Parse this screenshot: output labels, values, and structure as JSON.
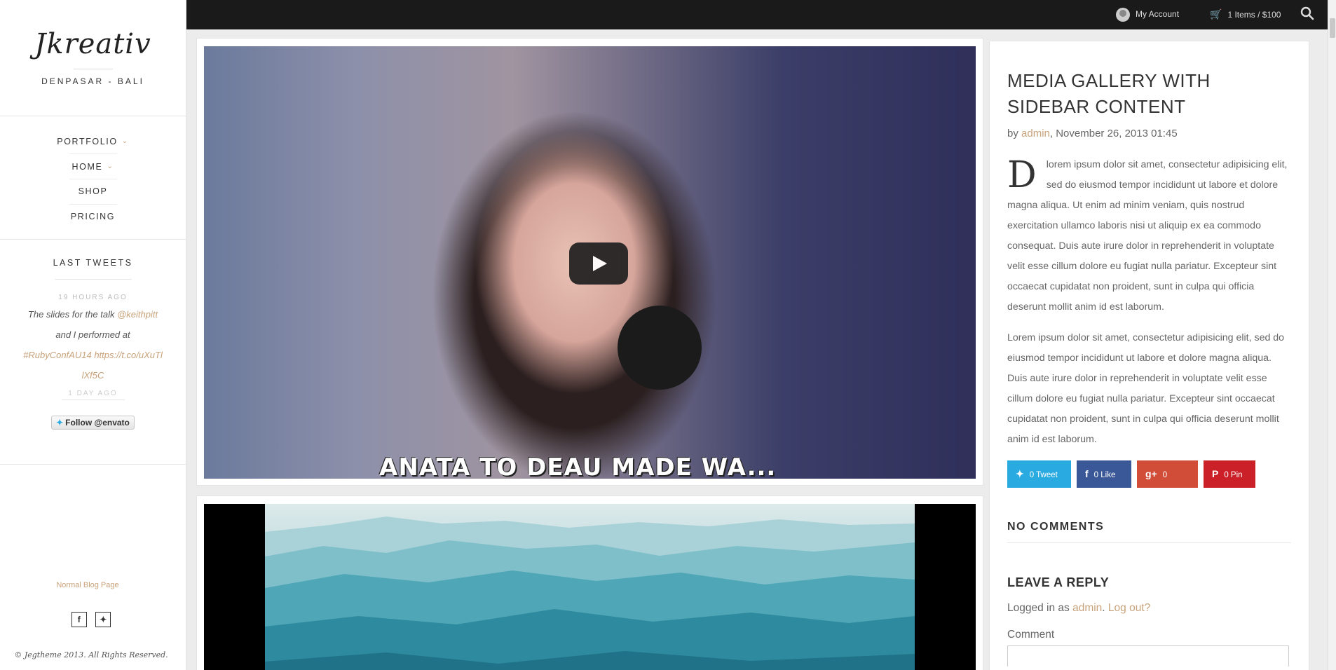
{
  "sidebar": {
    "brand": "Jkreativ",
    "tagline": "DENPASAR - BALI",
    "nav": [
      {
        "label": "PORTFOLIO",
        "has_submenu": true
      },
      {
        "label": "HOME",
        "has_submenu": true
      },
      {
        "label": "SHOP",
        "has_submenu": false
      },
      {
        "label": "PRICING",
        "has_submenu": false
      }
    ],
    "tweets": {
      "heading": "LAST TWEETS",
      "time": "19 HOURS AGO",
      "text_1": "The slides for the talk ",
      "mention": "@keithpitt",
      "text_2": " and I performed at ",
      "hashtag": "#RubyConfAU14",
      "text_3": " ",
      "link": "https://t.co/uXuTllXf5C",
      "next_time": "1 DAY AGO"
    },
    "follow_button": "Follow @envato",
    "blog_link": "Normal Blog Page",
    "copyright": "© Jegtheme 2013. All Rights Reserved."
  },
  "topbar": {
    "account": "My Account",
    "cart": "1 Items / $100",
    "icons": [
      "avatar-icon",
      "cart-icon",
      "search-icon"
    ]
  },
  "media": {
    "video_subtitle": "ANATA TO DEAU MADE WA..."
  },
  "post": {
    "title": "MEDIA GALLERY WITH SIDEBAR CONTENT",
    "by": "by ",
    "author": "admin",
    "date": ", November 26, 2013 01:45",
    "dropcap": "D",
    "paragraph_1": "lorem ipsum dolor sit amet, consectetur adipisicing elit, sed do eiusmod tempor incididunt ut labore et dolore magna aliqua. Ut enim ad minim veniam, quis nostrud exercitation ullamco laboris nisi ut aliquip ex ea commodo consequat. Duis aute irure dolor in reprehenderit in voluptate velit esse cillum dolore eu fugiat nulla pariatur. Excepteur sint occaecat cupidatat non proident, sunt in culpa qui officia deserunt mollit anim id est laborum.",
    "paragraph_2": "Lorem ipsum dolor sit amet, consectetur adipisicing elit, sed do eiusmod tempor incididunt ut labore et dolore magna aliqua. Duis aute irure dolor in reprehenderit in voluptate velit esse cillum dolore eu fugiat nulla pariatur. Excepteur sint occaecat cupidatat non proident, sunt in culpa qui officia deserunt mollit anim id est laborum."
  },
  "share": {
    "tweet": "0 Tweet",
    "like": "0 Like",
    "gshare": "0 Share",
    "pin": "0 Pin",
    "colors": {
      "twitter": "#29aae1",
      "facebook": "#3a5897",
      "google": "#d24d38",
      "pinterest": "#cb2027"
    }
  },
  "comments": {
    "no_comments": "NO COMMENTS",
    "leave_reply": "LEAVE A REPLY",
    "logged_in_prefix": "Logged in as ",
    "logged_user": "admin",
    "logged_sep": ". ",
    "logout": "Log out?",
    "comment_label": "Comment"
  },
  "colors": {
    "accent": "#c8a27a",
    "topbar": "#1a1a1a"
  }
}
